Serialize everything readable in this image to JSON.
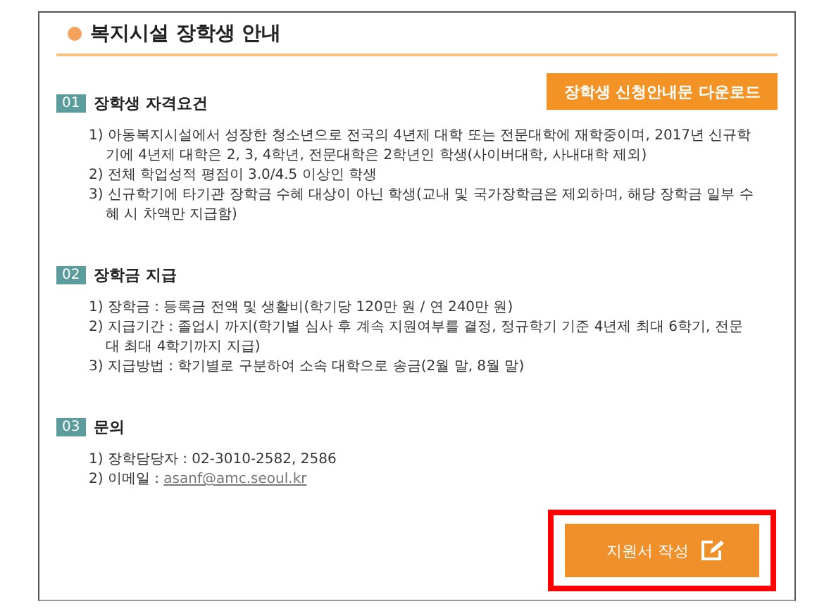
{
  "title": "복지시설 장학생 안내",
  "download_button": "장학생 신청안내문 다운로드",
  "sections": [
    {
      "number": "01",
      "heading": "장학생 자격요건",
      "items": [
        {
          "text": "1) 아동복지시설에서 성장한 청소년으로 전국의 4년제 대학 또는 전문대학에 재학중이며, 2017년 신규학기에 4년제 대학은 2, 3, 4학년, 전문대학은 2학년인 학생(사이버대학, 사내대학 제외)"
        },
        {
          "text": "2) 전체 학업성적 평점이 3.0/4.5 이상인 학생"
        },
        {
          "text": "3) 신규학기에 타기관 장학금 수혜 대상이 아닌 학생(교내 및 국가장학금은 제외하며, 해당 장학금 일부 수혜 시 차액만 지급함)"
        }
      ]
    },
    {
      "number": "02",
      "heading": "장학금 지급",
      "items": [
        {
          "text": "1) 장학금 : 등록금 전액 및 생활비(학기당 120만 원 / 연 240만 원)"
        },
        {
          "text": "2) 지급기간 : 졸업시 까지(학기별 심사 후 계속 지원여부를 결정, 정규학기 기준 4년제 최대 6학기, 전문대 최대 4학기까지 지급)"
        },
        {
          "text": "3) 지급방법 : 학기별로 구분하여 소속 대학으로 송금(2월 말, 8월 말)"
        }
      ]
    },
    {
      "number": "03",
      "heading": "문의",
      "items": [
        {
          "text": "1) 장학담당자 : 02-3010-2582, 2586"
        },
        {
          "text": "2) 이메일 : ",
          "link": "asanf@amc.seoul.kr"
        }
      ]
    }
  ],
  "apply_button": {
    "label": "지원서 작성",
    "highlighted": true
  }
}
